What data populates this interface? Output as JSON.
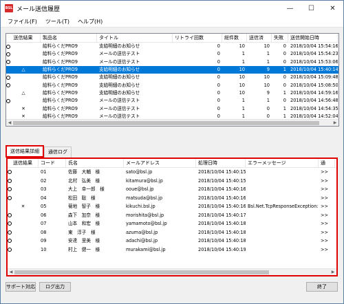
{
  "window": {
    "title": "メール送信履歴",
    "icon_text": "BSL"
  },
  "menu": [
    "ファイル(F)",
    "ツール(T)",
    "ヘルプ(H)"
  ],
  "history": {
    "columns": [
      "送信結果",
      "製品名",
      "タイトル",
      "リトライ回数",
      "総件数",
      "送信済",
      "失敗",
      "送信開始日時"
    ],
    "rows": [
      {
        "result": "circle",
        "product": "給料らくだPRO9",
        "title": "支給明細のお知らせ",
        "retry": "0",
        "total": "10",
        "sent": "10",
        "fail": "0",
        "start": "2018/10/04 15:54:16",
        "selected": false
      },
      {
        "result": "circle",
        "product": "給料らくだPRO9",
        "title": "メールの送信テスト",
        "retry": "0",
        "total": "1",
        "sent": "1",
        "fail": "0",
        "start": "2018/10/04 15:54:23",
        "selected": false
      },
      {
        "result": "circle",
        "product": "給料らくだPRO9",
        "title": "メールの送信テスト",
        "retry": "0",
        "total": "1",
        "sent": "1",
        "fail": "0",
        "start": "2018/10/04 15:53:06",
        "selected": false
      },
      {
        "result": "triangle",
        "product": "給料らくだPRO9",
        "title": "支給明細のお知らせ",
        "retry": "0",
        "total": "10",
        "sent": "9",
        "fail": "1",
        "start": "2018/10/04 15:40:14",
        "selected": true
      },
      {
        "result": "circle",
        "product": "給料らくだPRO9",
        "title": "支給明細のお知らせ",
        "retry": "0",
        "total": "10",
        "sent": "10",
        "fail": "0",
        "start": "2018/10/04 15:09:48",
        "selected": false
      },
      {
        "result": "circle",
        "product": "給料らくだPRO9",
        "title": "支給明細のお知らせ",
        "retry": "0",
        "total": "10",
        "sent": "10",
        "fail": "0",
        "start": "2018/10/04 15:08:50",
        "selected": false
      },
      {
        "result": "triangle",
        "product": "給料らくだPRO9",
        "title": "支給明細のお知らせ",
        "retry": "0",
        "total": "10",
        "sent": "9",
        "fail": "1",
        "start": "2018/10/04 14:59:16",
        "selected": false
      },
      {
        "result": "circle",
        "product": "給料らくだPRO9",
        "title": "メールの送信テスト",
        "retry": "0",
        "total": "1",
        "sent": "1",
        "fail": "0",
        "start": "2018/10/04 14:56:48",
        "selected": false
      },
      {
        "result": "cross",
        "product": "給料らくだPRO9",
        "title": "メールの送信テスト",
        "retry": "0",
        "total": "1",
        "sent": "0",
        "fail": "1",
        "start": "2018/10/04 14:54:35",
        "selected": false
      },
      {
        "result": "cross",
        "product": "給料らくだPRO9",
        "title": "メールの送信テスト",
        "retry": "0",
        "total": "1",
        "sent": "0",
        "fail": "1",
        "start": "2018/10/04 14:52:04",
        "selected": false
      }
    ]
  },
  "tabs": [
    "送信結果詳細",
    "通信ログ"
  ],
  "detail": {
    "columns": [
      "送信結果",
      "コード",
      "氏名",
      "メールアドレス",
      "処理日時",
      "エラーメッセージ",
      "通"
    ],
    "rows": [
      {
        "result": "circle",
        "code": "01",
        "name": "佐藤　大輔　様",
        "email": "sato@bsl.jp",
        "time": "2018/10/04 15:40:15",
        "error": "",
        "more": ">>"
      },
      {
        "result": "circle",
        "code": "02",
        "name": "北村　弘美　様",
        "email": "kitamura@bsl.jp",
        "time": "2018/10/04 15:40:15",
        "error": "",
        "more": ">>"
      },
      {
        "result": "circle",
        "code": "03",
        "name": "大上　幸一郎　様",
        "email": "ooue@bsl.jp",
        "time": "2018/10/04 15:40:16",
        "error": "",
        "more": ">>"
      },
      {
        "result": "circle",
        "code": "04",
        "name": "松田　聡　様",
        "email": "matsuda@bsl.jp",
        "time": "2018/10/04 15:40:16",
        "error": "",
        "more": ">>"
      },
      {
        "result": "cross",
        "code": "05",
        "name": "菊地　智子　様",
        "email": "kikuchi.bsl.jp",
        "time": "2018/10/04 15:40:16",
        "error": "Bsl.Net.TcpResponseException:",
        "more": ">>"
      },
      {
        "result": "circle",
        "code": "06",
        "name": "森下　加奈　様",
        "email": "morishita@bsl.jp",
        "time": "2018/10/04 15:40:17",
        "error": "",
        "more": ">>"
      },
      {
        "result": "circle",
        "code": "07",
        "name": "山本　和宏　様",
        "email": "yamamoto@bsl.jp",
        "time": "2018/10/04 15:40:18",
        "error": "",
        "more": ">>"
      },
      {
        "result": "circle",
        "code": "08",
        "name": "東　淳子　様",
        "email": "azuma@bsl.jp",
        "time": "2018/10/04 15:40:18",
        "error": "",
        "more": ">>"
      },
      {
        "result": "circle",
        "code": "09",
        "name": "安達　里美　様",
        "email": "adachi@bsl.jp",
        "time": "2018/10/04 15:40:18",
        "error": "",
        "more": ">>"
      },
      {
        "result": "circle",
        "code": "10",
        "name": "村上　健一　様",
        "email": "murakami@bsl.jp",
        "time": "2018/10/04 15:40:19",
        "error": "",
        "more": ">>"
      }
    ]
  },
  "buttons": {
    "support": "サポート対応",
    "log_output": "ログ出力",
    "close": "終了"
  },
  "colors": {
    "selection": "#0078d7",
    "highlight": "#e00000"
  }
}
